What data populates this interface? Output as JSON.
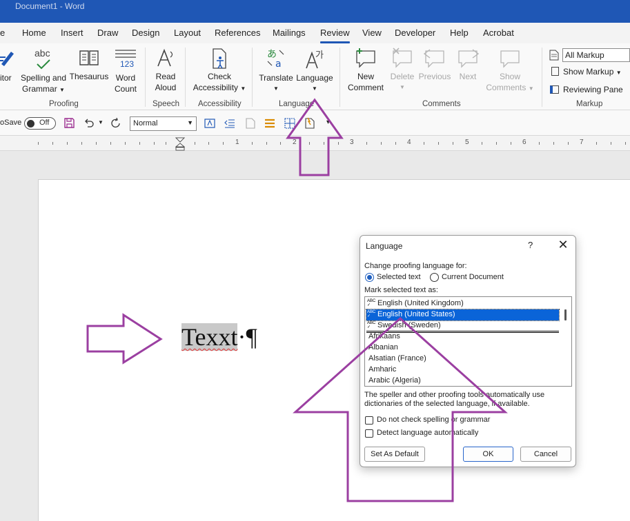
{
  "titlebar": {
    "title": "Document1  -  Word"
  },
  "menu": {
    "file_stub": "e",
    "tabs": [
      "Home",
      "Insert",
      "Draw",
      "Design",
      "Layout",
      "References",
      "Mailings",
      "Review",
      "View",
      "Developer",
      "Help",
      "Acrobat"
    ],
    "active": "Review"
  },
  "ribbon": {
    "editor_stub": "itor",
    "spelling": {
      "line1": "Spelling and",
      "line2": "Grammar",
      "icon_text": "abc"
    },
    "thesaurus": "Thesaurus",
    "word_count": {
      "line1": "Word",
      "line2": "Count",
      "icon_text": "123"
    },
    "read_aloud": {
      "line1": "Read",
      "line2": "Aloud"
    },
    "check_access": {
      "line1": "Check",
      "line2": "Accessibility"
    },
    "translate": "Translate",
    "language": "Language",
    "new_comment": {
      "line1": "New",
      "line2": "Comment"
    },
    "delete": "Delete",
    "previous": "Previous",
    "next": "Next",
    "show_comments": {
      "line1": "Show",
      "line2": "Comments"
    },
    "markup_select": "All Markup",
    "show_markup": "Show Markup",
    "reviewing_pane": "Reviewing Pane",
    "groups": {
      "proofing": "Proofing",
      "speech": "Speech",
      "accessibility": "Accessibility",
      "language": "Language",
      "comments": "Comments",
      "markup": "Markup"
    }
  },
  "qat": {
    "autosave_stub": "oSave",
    "autosave_state": "Off",
    "style": "Normal"
  },
  "ruler": {
    "numbers": [
      "1",
      "2",
      "3",
      "4",
      "5",
      "6",
      "7"
    ]
  },
  "document": {
    "text": "Texxt",
    "mark": "·¶"
  },
  "dialog": {
    "title": "Language",
    "help": "?",
    "change_label": "Change proofing language for:",
    "radio_selected": "Selected text",
    "radio_document": "Current Document",
    "mark_label": "Mark selected text as:",
    "languages": [
      {
        "name": "English (United Kingdom)",
        "proof": true,
        "selected": false
      },
      {
        "name": "English (United States)",
        "proof": true,
        "selected": true
      },
      {
        "name": "Swedish (Sweden)",
        "proof": true,
        "selected": false
      },
      {
        "name": "Afrikaans",
        "proof": false,
        "selected": false
      },
      {
        "name": "Albanian",
        "proof": false,
        "selected": false
      },
      {
        "name": "Alsatian (France)",
        "proof": false,
        "selected": false
      },
      {
        "name": "Amharic",
        "proof": false,
        "selected": false
      },
      {
        "name": "Arabic (Algeria)",
        "proof": false,
        "selected": false
      }
    ],
    "description": "The speller and other proofing tools automatically use dictionaries of the selected language, if available.",
    "check_no_spelling": "Do not check spelling or grammar",
    "check_detect": "Detect language automatically",
    "set_default": "Set As Default",
    "ok": "OK",
    "cancel": "Cancel"
  },
  "colors": {
    "titlebar": "#1f57b5",
    "accent": "#1f57b5",
    "list_selection": "#0a64d8",
    "annotation_arrows": "#9b3fa1"
  }
}
